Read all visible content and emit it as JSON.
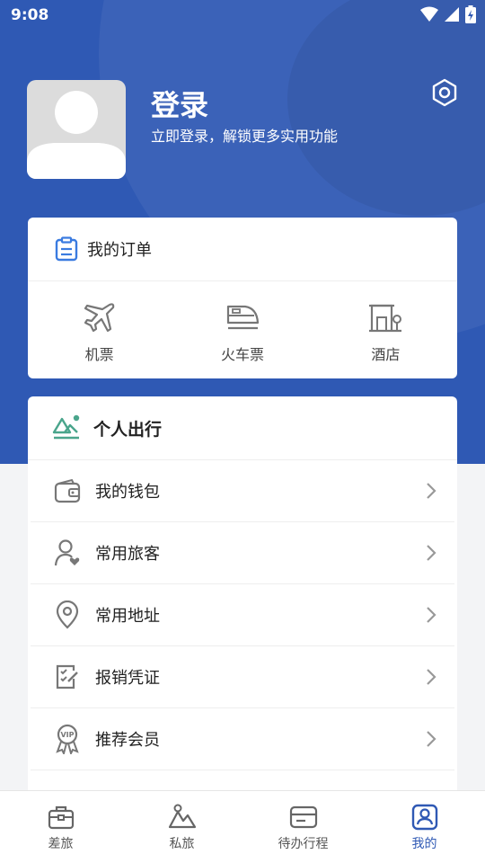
{
  "status_bar": {
    "time": "9:08"
  },
  "profile": {
    "title": "登录",
    "subtitle": "立即登录，解锁更多实用功能"
  },
  "orders": {
    "title": "我的订单",
    "items": [
      {
        "label": "机票",
        "icon": "airplane-icon"
      },
      {
        "label": "火车票",
        "icon": "train-icon"
      },
      {
        "label": "酒店",
        "icon": "hotel-icon"
      }
    ]
  },
  "personal": {
    "title": "个人出行",
    "items": [
      {
        "label": "我的钱包",
        "icon": "wallet-icon"
      },
      {
        "label": "常用旅客",
        "icon": "traveler-icon"
      },
      {
        "label": "常用地址",
        "icon": "location-icon"
      },
      {
        "label": "报销凭证",
        "icon": "voucher-icon"
      },
      {
        "label": "推荐会员",
        "icon": "vip-badge-icon"
      }
    ]
  },
  "tabbar": {
    "items": [
      {
        "label": "差旅",
        "icon": "briefcase-icon",
        "active": false
      },
      {
        "label": "私旅",
        "icon": "mountain-icon",
        "active": false
      },
      {
        "label": "待办行程",
        "icon": "card-icon",
        "active": false
      },
      {
        "label": "我的",
        "icon": "profile-icon",
        "active": true
      }
    ]
  },
  "colors": {
    "brand_blue": "#2f59b4",
    "order_icon_blue": "#3a7be0",
    "personal_icon_green": "#4aa58c",
    "icon_gray": "#777777"
  }
}
